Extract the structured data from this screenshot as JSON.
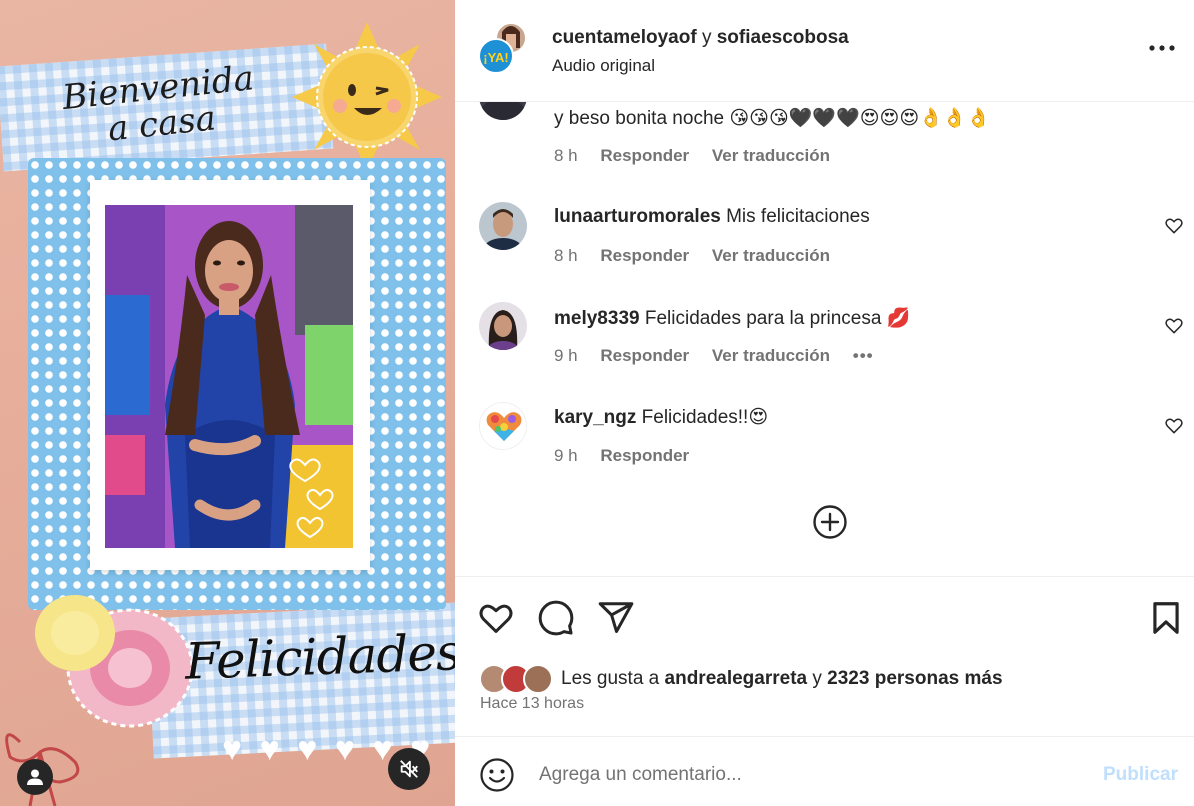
{
  "media": {
    "title_script": "Bienvenida a casa",
    "felicidades": "Felicidades",
    "hearts": "♥ ♥ ♥ ♥ ♥ ♥",
    "user_icon": "user-icon",
    "mute_icon": "volume-muted-icon"
  },
  "header": {
    "username_1": "cuentameloyaof",
    "and": "y",
    "username_2": "sofiaescobosa",
    "audio": "Audio original",
    "more_icon": "more-horizontal-icon"
  },
  "comments": [
    {
      "user": "",
      "text": "y beso bonita noche 😘😘😘🖤🖤🖤😍😍😍👌👌👌",
      "time": "8 h",
      "reply": "Responder",
      "translate": "Ver traducción"
    },
    {
      "user": "lunaarturomorales",
      "text": "Mis felicitaciones",
      "time": "8 h",
      "reply": "Responder",
      "translate": "Ver traducción"
    },
    {
      "user": "mely8339",
      "text": "Felicidades para la princesa 💋",
      "time": "9 h",
      "reply": "Responder",
      "translate": "Ver traducción",
      "more": "•••"
    },
    {
      "user": "kary_ngz",
      "text": "Felicidades!!😍",
      "time": "9 h",
      "reply": "Responder"
    }
  ],
  "actions": {
    "like_icon": "heart-icon",
    "comment_icon": "comment-icon",
    "share_icon": "paper-plane-icon",
    "save_icon": "bookmark-icon"
  },
  "likes": {
    "prefix": "Les gusta a ",
    "user": "andrealegarreta",
    "middle": " y ",
    "count": "2323 personas más"
  },
  "time_ago": "Hace 13 horas",
  "composer": {
    "placeholder": "Agrega un comentario...",
    "publish": "Publicar"
  },
  "colors": {
    "text": "#262626",
    "muted": "#737373",
    "publish_disabled": "#c0dffd",
    "frame_blue": "#7fc1ea",
    "background_pink": "#e7ae9b"
  }
}
